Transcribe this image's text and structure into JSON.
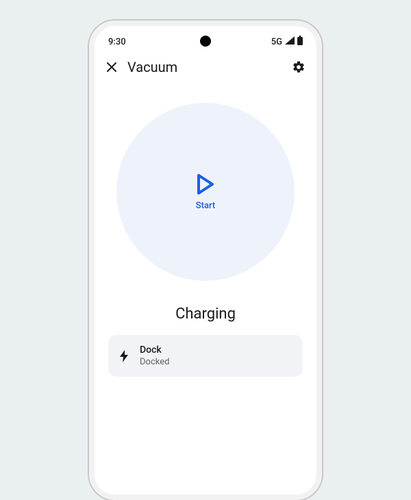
{
  "status_bar": {
    "time": "9:30",
    "network": "5G"
  },
  "header": {
    "title": "Vacuum"
  },
  "main": {
    "start_label": "Start",
    "status": "Charging"
  },
  "card": {
    "title": "Dock",
    "subtitle": "Docked"
  }
}
